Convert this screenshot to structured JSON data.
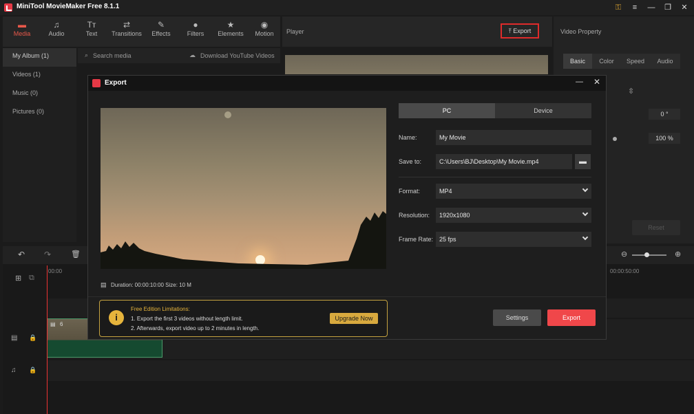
{
  "app": {
    "title": "MiniTool MovieMaker Free 8.1.1"
  },
  "toolbar": {
    "tabs": [
      {
        "label": "Media",
        "icon": "folder-icon"
      },
      {
        "label": "Audio",
        "icon": "music-icon"
      },
      {
        "label": "Text",
        "icon": "text-icon"
      },
      {
        "label": "Transitions",
        "icon": "transitions-icon"
      },
      {
        "label": "Effects",
        "icon": "effects-icon"
      },
      {
        "label": "Filters",
        "icon": "filters-icon"
      },
      {
        "label": "Elements",
        "icon": "elements-icon"
      },
      {
        "label": "Motion",
        "icon": "motion-icon"
      }
    ]
  },
  "album": {
    "items": [
      "My Album (1)",
      "Videos (1)",
      "Music (0)",
      "Pictures (0)"
    ]
  },
  "media": {
    "search_placeholder": "Search media",
    "download_label": "Download YouTube Videos"
  },
  "player": {
    "label": "Player",
    "export_label": "Export"
  },
  "property": {
    "label": "Video Property",
    "tabs": [
      "Basic",
      "Color",
      "Speed",
      "Audio"
    ],
    "rotation": "0 °",
    "scale": "100 %",
    "reset_label": "Reset"
  },
  "timeline": {
    "start_time": "00:00",
    "end_time": "00:00:50:00",
    "clip_count": "6"
  },
  "export": {
    "title": "Export",
    "targets": [
      "PC",
      "Device"
    ],
    "name_label": "Name:",
    "name_value": "My Movie",
    "save_label": "Save to:",
    "save_value": "C:\\Users\\BJ\\Desktop\\My Movie.mp4",
    "format_label": "Format:",
    "format_value": "MP4",
    "resolution_label": "Resolution:",
    "resolution_value": "1920x1080",
    "framerate_label": "Frame Rate:",
    "framerate_value": "25 fps",
    "duration_text": "Duration:  00:00:10:00  Size:  10 M",
    "limits_title": "Free Edition Limitations:",
    "limit_1": "1. Export the first 3 videos without length limit.",
    "limit_2": "2. Afterwards, export video up to 2 minutes in length.",
    "upgrade_label": "Upgrade Now",
    "settings_label": "Settings",
    "export_label": "Export"
  },
  "colors": {
    "accent": "#e8584a",
    "export_button": "#f0474a",
    "notice_border": "#c6a340"
  }
}
